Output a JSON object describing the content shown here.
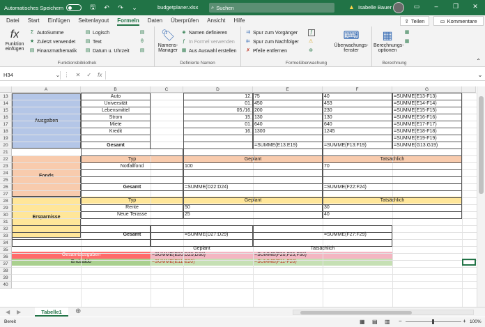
{
  "titlebar": {
    "autosave_label": "Automatisches Speichern",
    "filename": "budgetplaner.xlsx",
    "search_placeholder": "Suchen",
    "user_name": "Isabelle Bauer"
  },
  "tabs": [
    "Datei",
    "Start",
    "Einfügen",
    "Seitenlayout",
    "Formeln",
    "Daten",
    "Überprüfen",
    "Ansicht",
    "Hilfe"
  ],
  "share_label": "Teilen",
  "comment_label": "Kommentare",
  "ribbon": {
    "insert_function_label": "Funktion einfügen",
    "autosum": "AutoSumme",
    "recent": "Zuletzt verwendet",
    "financial": "Finanzmathematik",
    "logical": "Logisch",
    "text": "Text",
    "datetime": "Datum u. Uhrzeit",
    "group1_label": "Funktionsbibliothek",
    "name_manager": "Namens-Manager",
    "define_name": "Namen definieren",
    "use_in_formula": "In Formel verwenden",
    "create_from_selection": "Aus Auswahl erstellen",
    "group2_label": "Definierte Namen",
    "trace_precedents": "Spur zum Vorgänger",
    "trace_dependents": "Spur zum Nachfolger",
    "remove_arrows": "Pfeile entfernen",
    "watch_window": "Überwachungs-fenster",
    "group3_label": "Formelüberwachung",
    "calc_options": "Berechnungs-optionen",
    "group4_label": "Berechnung"
  },
  "formula_bar": {
    "name_box": "H34",
    "formula": ""
  },
  "columns": [
    "A",
    "B",
    "C",
    "D",
    "E",
    "F",
    "G"
  ],
  "rows": [
    "13",
    "14",
    "15",
    "16",
    "17",
    "18",
    "19",
    "20",
    "21",
    "22",
    "23",
    "24",
    "25",
    "26",
    "27",
    "28",
    "29",
    "30",
    "31",
    "32",
    "33",
    "34",
    "35",
    "36",
    "37",
    "38",
    "39",
    "40"
  ],
  "cells": {
    "ausgaben": "Ausgaben",
    "b13": "Auto",
    "d13": "12.",
    "e13": "75",
    "f13": "40",
    "g13": "=SUMME(E13-F13)",
    "b14": "Universität",
    "d14": "01.",
    "e14": "450",
    "f14": "453",
    "g14": "=SUMME(E14-F14)",
    "b15": "Lebensmittel",
    "d15": "05./16.",
    "e15": "200",
    "f15": "230",
    "g15": "=SUMME(E15-F15)",
    "b16": "Strom",
    "d16": "15.",
    "e16": "130",
    "f16": "130",
    "g16": "=SUMME(E16-F16)",
    "b17": "Miete",
    "d17": "01.",
    "e17": "640",
    "f17": "640",
    "g17": "=SUMME(E17-F17)",
    "b18": "Kredit",
    "d18": "16.",
    "e18": "1300",
    "f18": "1245",
    "g18": "=SUMME(E18-F18)",
    "g19": "=SUMME(E19-F19)",
    "b20": "Gesamt",
    "e20": "=SUMME(E13:E19)",
    "f20": "=SUMME(F13:F19)",
    "g20": "=SUMME(G13:G19)",
    "fonds": "Fonds",
    "b21": "Typ",
    "d21": "Geplant",
    "f21": "Tatsächlich",
    "b22": "Notfallfond",
    "d22": "100",
    "f22": "70",
    "b25": "Gesamt",
    "d25": "=SUMME(D22:D24)",
    "f25": "=SUMME(F22:F24)",
    "ersparnisse": "Ersparnisse",
    "b26": "Typ",
    "d26": "Geplant",
    "f26": "Tatsächlich",
    "b27": "Rente",
    "d27": "50",
    "f27": "30",
    "b28": "Neue Terasse",
    "d28": "25",
    "f28": "40",
    "b30": "Gesamt",
    "d30": "=SUMME(D27:D29)",
    "f30": "=SUMME(F27:F29)",
    "d32": "Geplant",
    "f32": "Tatsächlich",
    "a33": "Gesamtausgaben",
    "d33": "=SUMME(E20,D25,D30)",
    "f33": "=SUMME(F20,F25,F30)",
    "a34": "Endsaldo",
    "d34": "=SUMME(E11-E20)",
    "f34": "=SUMME(F11-F20)"
  },
  "sheet_tab": "Tabelle1",
  "status": {
    "ready": "Bereit",
    "zoom": "100%"
  },
  "colors": {
    "excel_green": "#217346",
    "ausgaben_fill": "#b4c6e7",
    "fonds_fill": "#f8cbad",
    "ersparnisse_fill": "#ffe699",
    "gesamtausgaben_fill": "#ff6b6b",
    "endsaldo_fill": "#a9d08e",
    "pink_fill": "#f4b6c2",
    "lightgreen_fill": "#c6e0b4"
  }
}
